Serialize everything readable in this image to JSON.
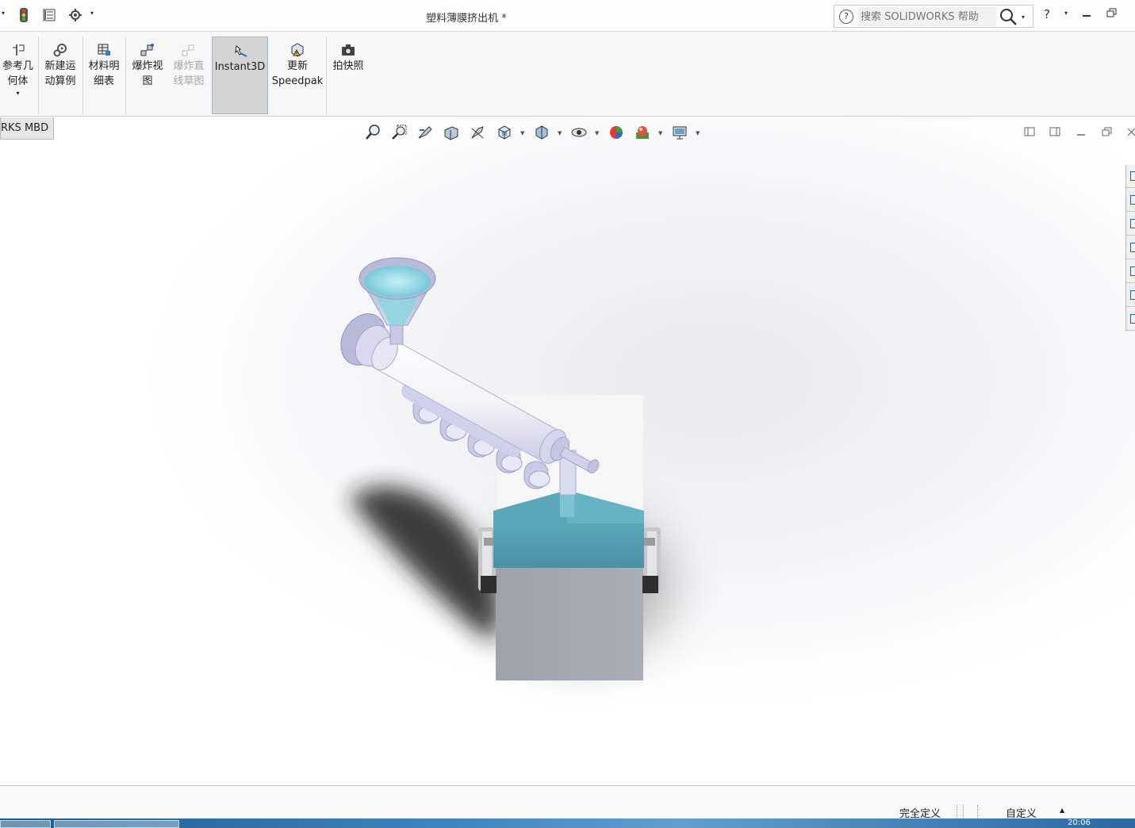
{
  "window": {
    "title": "塑料薄膜挤出机 *",
    "search_placeholder": "搜索 SOLIDWORKS 帮助",
    "help_label": "?"
  },
  "ribbon": {
    "buttons": [
      {
        "label": "参考几何体",
        "line1": "参考几",
        "line2": "何体",
        "icon": "reference-geometry-icon"
      },
      {
        "label": "新建运动算例",
        "line1": "新建运",
        "line2": "动算例",
        "icon": "motion-study-icon"
      },
      {
        "label": "材料明细表",
        "line1": "材料明",
        "line2": "细表",
        "icon": "bom-icon"
      },
      {
        "label": "爆炸视图",
        "line1": "爆炸视",
        "line2": "图",
        "icon": "exploded-view-icon"
      },
      {
        "label": "爆炸直线草图",
        "line1": "爆炸直",
        "line2": "线草图",
        "icon": "explode-line-sketch-icon"
      },
      {
        "label": "Instant3D",
        "line1": "Instant3D",
        "line2": "",
        "icon": "instant3d-icon"
      },
      {
        "label": "更新Speedpak",
        "line1": "更新",
        "line2": "Speedpak",
        "icon": "speedpak-icon"
      },
      {
        "label": "拍快照",
        "line1": "拍快照",
        "line2": "",
        "icon": "camera-icon"
      }
    ]
  },
  "viewport": {
    "tab_label": "RKS MBD"
  },
  "statusbar": {
    "definition": "完全定义",
    "units": "自定义"
  },
  "taskbar": {
    "clock": "20:06"
  },
  "colors": {
    "accent": "#4a8fa8",
    "model_teal": "#4f9aab",
    "model_grey": "#a3a7af",
    "model_lavender": "#c9cbe8"
  }
}
